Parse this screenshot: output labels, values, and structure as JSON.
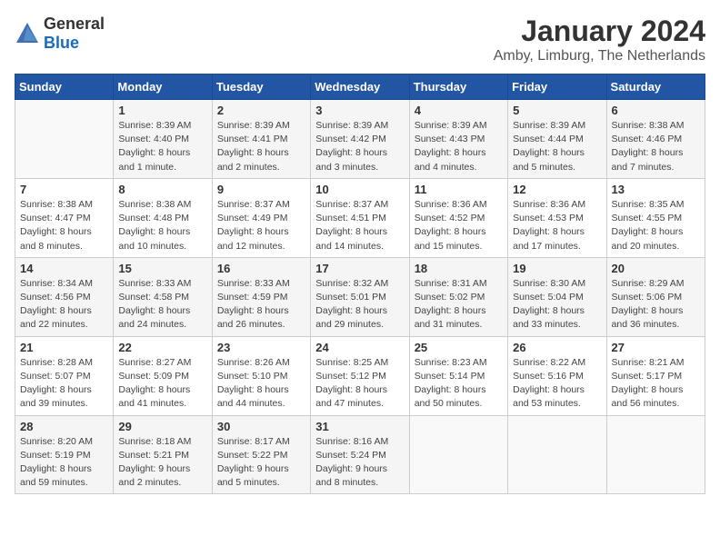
{
  "logo": {
    "general": "General",
    "blue": "Blue"
  },
  "header": {
    "month": "January 2024",
    "location": "Amby, Limburg, The Netherlands"
  },
  "weekdays": [
    "Sunday",
    "Monday",
    "Tuesday",
    "Wednesday",
    "Thursday",
    "Friday",
    "Saturday"
  ],
  "weeks": [
    [
      {
        "day": "",
        "sunrise": "",
        "sunset": "",
        "daylight": ""
      },
      {
        "day": "1",
        "sunrise": "Sunrise: 8:39 AM",
        "sunset": "Sunset: 4:40 PM",
        "daylight": "Daylight: 8 hours and 1 minute."
      },
      {
        "day": "2",
        "sunrise": "Sunrise: 8:39 AM",
        "sunset": "Sunset: 4:41 PM",
        "daylight": "Daylight: 8 hours and 2 minutes."
      },
      {
        "day": "3",
        "sunrise": "Sunrise: 8:39 AM",
        "sunset": "Sunset: 4:42 PM",
        "daylight": "Daylight: 8 hours and 3 minutes."
      },
      {
        "day": "4",
        "sunrise": "Sunrise: 8:39 AM",
        "sunset": "Sunset: 4:43 PM",
        "daylight": "Daylight: 8 hours and 4 minutes."
      },
      {
        "day": "5",
        "sunrise": "Sunrise: 8:39 AM",
        "sunset": "Sunset: 4:44 PM",
        "daylight": "Daylight: 8 hours and 5 minutes."
      },
      {
        "day": "6",
        "sunrise": "Sunrise: 8:38 AM",
        "sunset": "Sunset: 4:46 PM",
        "daylight": "Daylight: 8 hours and 7 minutes."
      }
    ],
    [
      {
        "day": "7",
        "sunrise": "Sunrise: 8:38 AM",
        "sunset": "Sunset: 4:47 PM",
        "daylight": "Daylight: 8 hours and 8 minutes."
      },
      {
        "day": "8",
        "sunrise": "Sunrise: 8:38 AM",
        "sunset": "Sunset: 4:48 PM",
        "daylight": "Daylight: 8 hours and 10 minutes."
      },
      {
        "day": "9",
        "sunrise": "Sunrise: 8:37 AM",
        "sunset": "Sunset: 4:49 PM",
        "daylight": "Daylight: 8 hours and 12 minutes."
      },
      {
        "day": "10",
        "sunrise": "Sunrise: 8:37 AM",
        "sunset": "Sunset: 4:51 PM",
        "daylight": "Daylight: 8 hours and 14 minutes."
      },
      {
        "day": "11",
        "sunrise": "Sunrise: 8:36 AM",
        "sunset": "Sunset: 4:52 PM",
        "daylight": "Daylight: 8 hours and 15 minutes."
      },
      {
        "day": "12",
        "sunrise": "Sunrise: 8:36 AM",
        "sunset": "Sunset: 4:53 PM",
        "daylight": "Daylight: 8 hours and 17 minutes."
      },
      {
        "day": "13",
        "sunrise": "Sunrise: 8:35 AM",
        "sunset": "Sunset: 4:55 PM",
        "daylight": "Daylight: 8 hours and 20 minutes."
      }
    ],
    [
      {
        "day": "14",
        "sunrise": "Sunrise: 8:34 AM",
        "sunset": "Sunset: 4:56 PM",
        "daylight": "Daylight: 8 hours and 22 minutes."
      },
      {
        "day": "15",
        "sunrise": "Sunrise: 8:33 AM",
        "sunset": "Sunset: 4:58 PM",
        "daylight": "Daylight: 8 hours and 24 minutes."
      },
      {
        "day": "16",
        "sunrise": "Sunrise: 8:33 AM",
        "sunset": "Sunset: 4:59 PM",
        "daylight": "Daylight: 8 hours and 26 minutes."
      },
      {
        "day": "17",
        "sunrise": "Sunrise: 8:32 AM",
        "sunset": "Sunset: 5:01 PM",
        "daylight": "Daylight: 8 hours and 29 minutes."
      },
      {
        "day": "18",
        "sunrise": "Sunrise: 8:31 AM",
        "sunset": "Sunset: 5:02 PM",
        "daylight": "Daylight: 8 hours and 31 minutes."
      },
      {
        "day": "19",
        "sunrise": "Sunrise: 8:30 AM",
        "sunset": "Sunset: 5:04 PM",
        "daylight": "Daylight: 8 hours and 33 minutes."
      },
      {
        "day": "20",
        "sunrise": "Sunrise: 8:29 AM",
        "sunset": "Sunset: 5:06 PM",
        "daylight": "Daylight: 8 hours and 36 minutes."
      }
    ],
    [
      {
        "day": "21",
        "sunrise": "Sunrise: 8:28 AM",
        "sunset": "Sunset: 5:07 PM",
        "daylight": "Daylight: 8 hours and 39 minutes."
      },
      {
        "day": "22",
        "sunrise": "Sunrise: 8:27 AM",
        "sunset": "Sunset: 5:09 PM",
        "daylight": "Daylight: 8 hours and 41 minutes."
      },
      {
        "day": "23",
        "sunrise": "Sunrise: 8:26 AM",
        "sunset": "Sunset: 5:10 PM",
        "daylight": "Daylight: 8 hours and 44 minutes."
      },
      {
        "day": "24",
        "sunrise": "Sunrise: 8:25 AM",
        "sunset": "Sunset: 5:12 PM",
        "daylight": "Daylight: 8 hours and 47 minutes."
      },
      {
        "day": "25",
        "sunrise": "Sunrise: 8:23 AM",
        "sunset": "Sunset: 5:14 PM",
        "daylight": "Daylight: 8 hours and 50 minutes."
      },
      {
        "day": "26",
        "sunrise": "Sunrise: 8:22 AM",
        "sunset": "Sunset: 5:16 PM",
        "daylight": "Daylight: 8 hours and 53 minutes."
      },
      {
        "day": "27",
        "sunrise": "Sunrise: 8:21 AM",
        "sunset": "Sunset: 5:17 PM",
        "daylight": "Daylight: 8 hours and 56 minutes."
      }
    ],
    [
      {
        "day": "28",
        "sunrise": "Sunrise: 8:20 AM",
        "sunset": "Sunset: 5:19 PM",
        "daylight": "Daylight: 8 hours and 59 minutes."
      },
      {
        "day": "29",
        "sunrise": "Sunrise: 8:18 AM",
        "sunset": "Sunset: 5:21 PM",
        "daylight": "Daylight: 9 hours and 2 minutes."
      },
      {
        "day": "30",
        "sunrise": "Sunrise: 8:17 AM",
        "sunset": "Sunset: 5:22 PM",
        "daylight": "Daylight: 9 hours and 5 minutes."
      },
      {
        "day": "31",
        "sunrise": "Sunrise: 8:16 AM",
        "sunset": "Sunset: 5:24 PM",
        "daylight": "Daylight: 9 hours and 8 minutes."
      },
      {
        "day": "",
        "sunrise": "",
        "sunset": "",
        "daylight": ""
      },
      {
        "day": "",
        "sunrise": "",
        "sunset": "",
        "daylight": ""
      },
      {
        "day": "",
        "sunrise": "",
        "sunset": "",
        "daylight": ""
      }
    ]
  ]
}
